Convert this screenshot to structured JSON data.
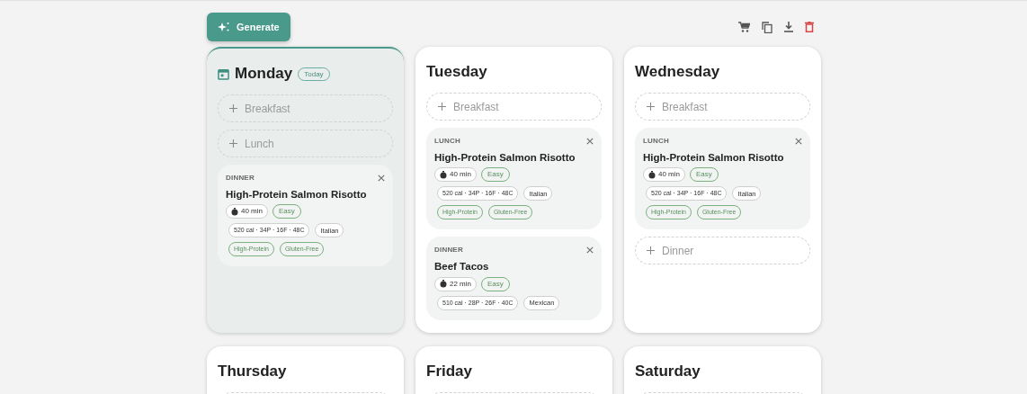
{
  "toolbar": {
    "generate_label": "Generate"
  },
  "days": [
    {
      "name": "Monday",
      "today": true,
      "today_badge": "Today",
      "slots": [
        {
          "kind": "empty",
          "label": "Breakfast"
        },
        {
          "kind": "empty",
          "label": "Lunch"
        },
        {
          "kind": "meal",
          "label": "DINNER",
          "title": "High-Protein Salmon Risotto",
          "time": "40 min",
          "difficulty": "Easy",
          "nutrition": "520 cal · 34P · 16F · 48C",
          "cuisine": "Italian",
          "tags": [
            "High-Protein",
            "Gluten-Free"
          ]
        }
      ]
    },
    {
      "name": "Tuesday",
      "today": false,
      "slots": [
        {
          "kind": "empty",
          "label": "Breakfast"
        },
        {
          "kind": "meal",
          "label": "LUNCH",
          "title": "High-Protein Salmon Risotto",
          "time": "40 min",
          "difficulty": "Easy",
          "nutrition": "520 cal · 34P · 16F · 48C",
          "cuisine": "Italian",
          "tags": [
            "High-Protein",
            "Gluten-Free"
          ]
        },
        {
          "kind": "meal",
          "label": "DINNER",
          "title": "Beef Tacos",
          "time": "22 min",
          "difficulty": "Easy",
          "nutrition": "510 cal · 28P · 26F · 40C",
          "cuisine": "Mexican"
        }
      ]
    },
    {
      "name": "Wednesday",
      "today": false,
      "slots": [
        {
          "kind": "empty",
          "label": "Breakfast"
        },
        {
          "kind": "meal",
          "label": "LUNCH",
          "title": "High-Protein Salmon Risotto",
          "time": "40 min",
          "difficulty": "Easy",
          "nutrition": "520 cal · 34P · 16F · 48C",
          "cuisine": "Italian",
          "tags": [
            "High-Protein",
            "Gluten-Free"
          ]
        },
        {
          "kind": "empty",
          "label": "Dinner"
        }
      ]
    },
    {
      "name": "Thursday",
      "today": false
    },
    {
      "name": "Friday",
      "today": false
    },
    {
      "name": "Saturday",
      "today": false
    }
  ]
}
